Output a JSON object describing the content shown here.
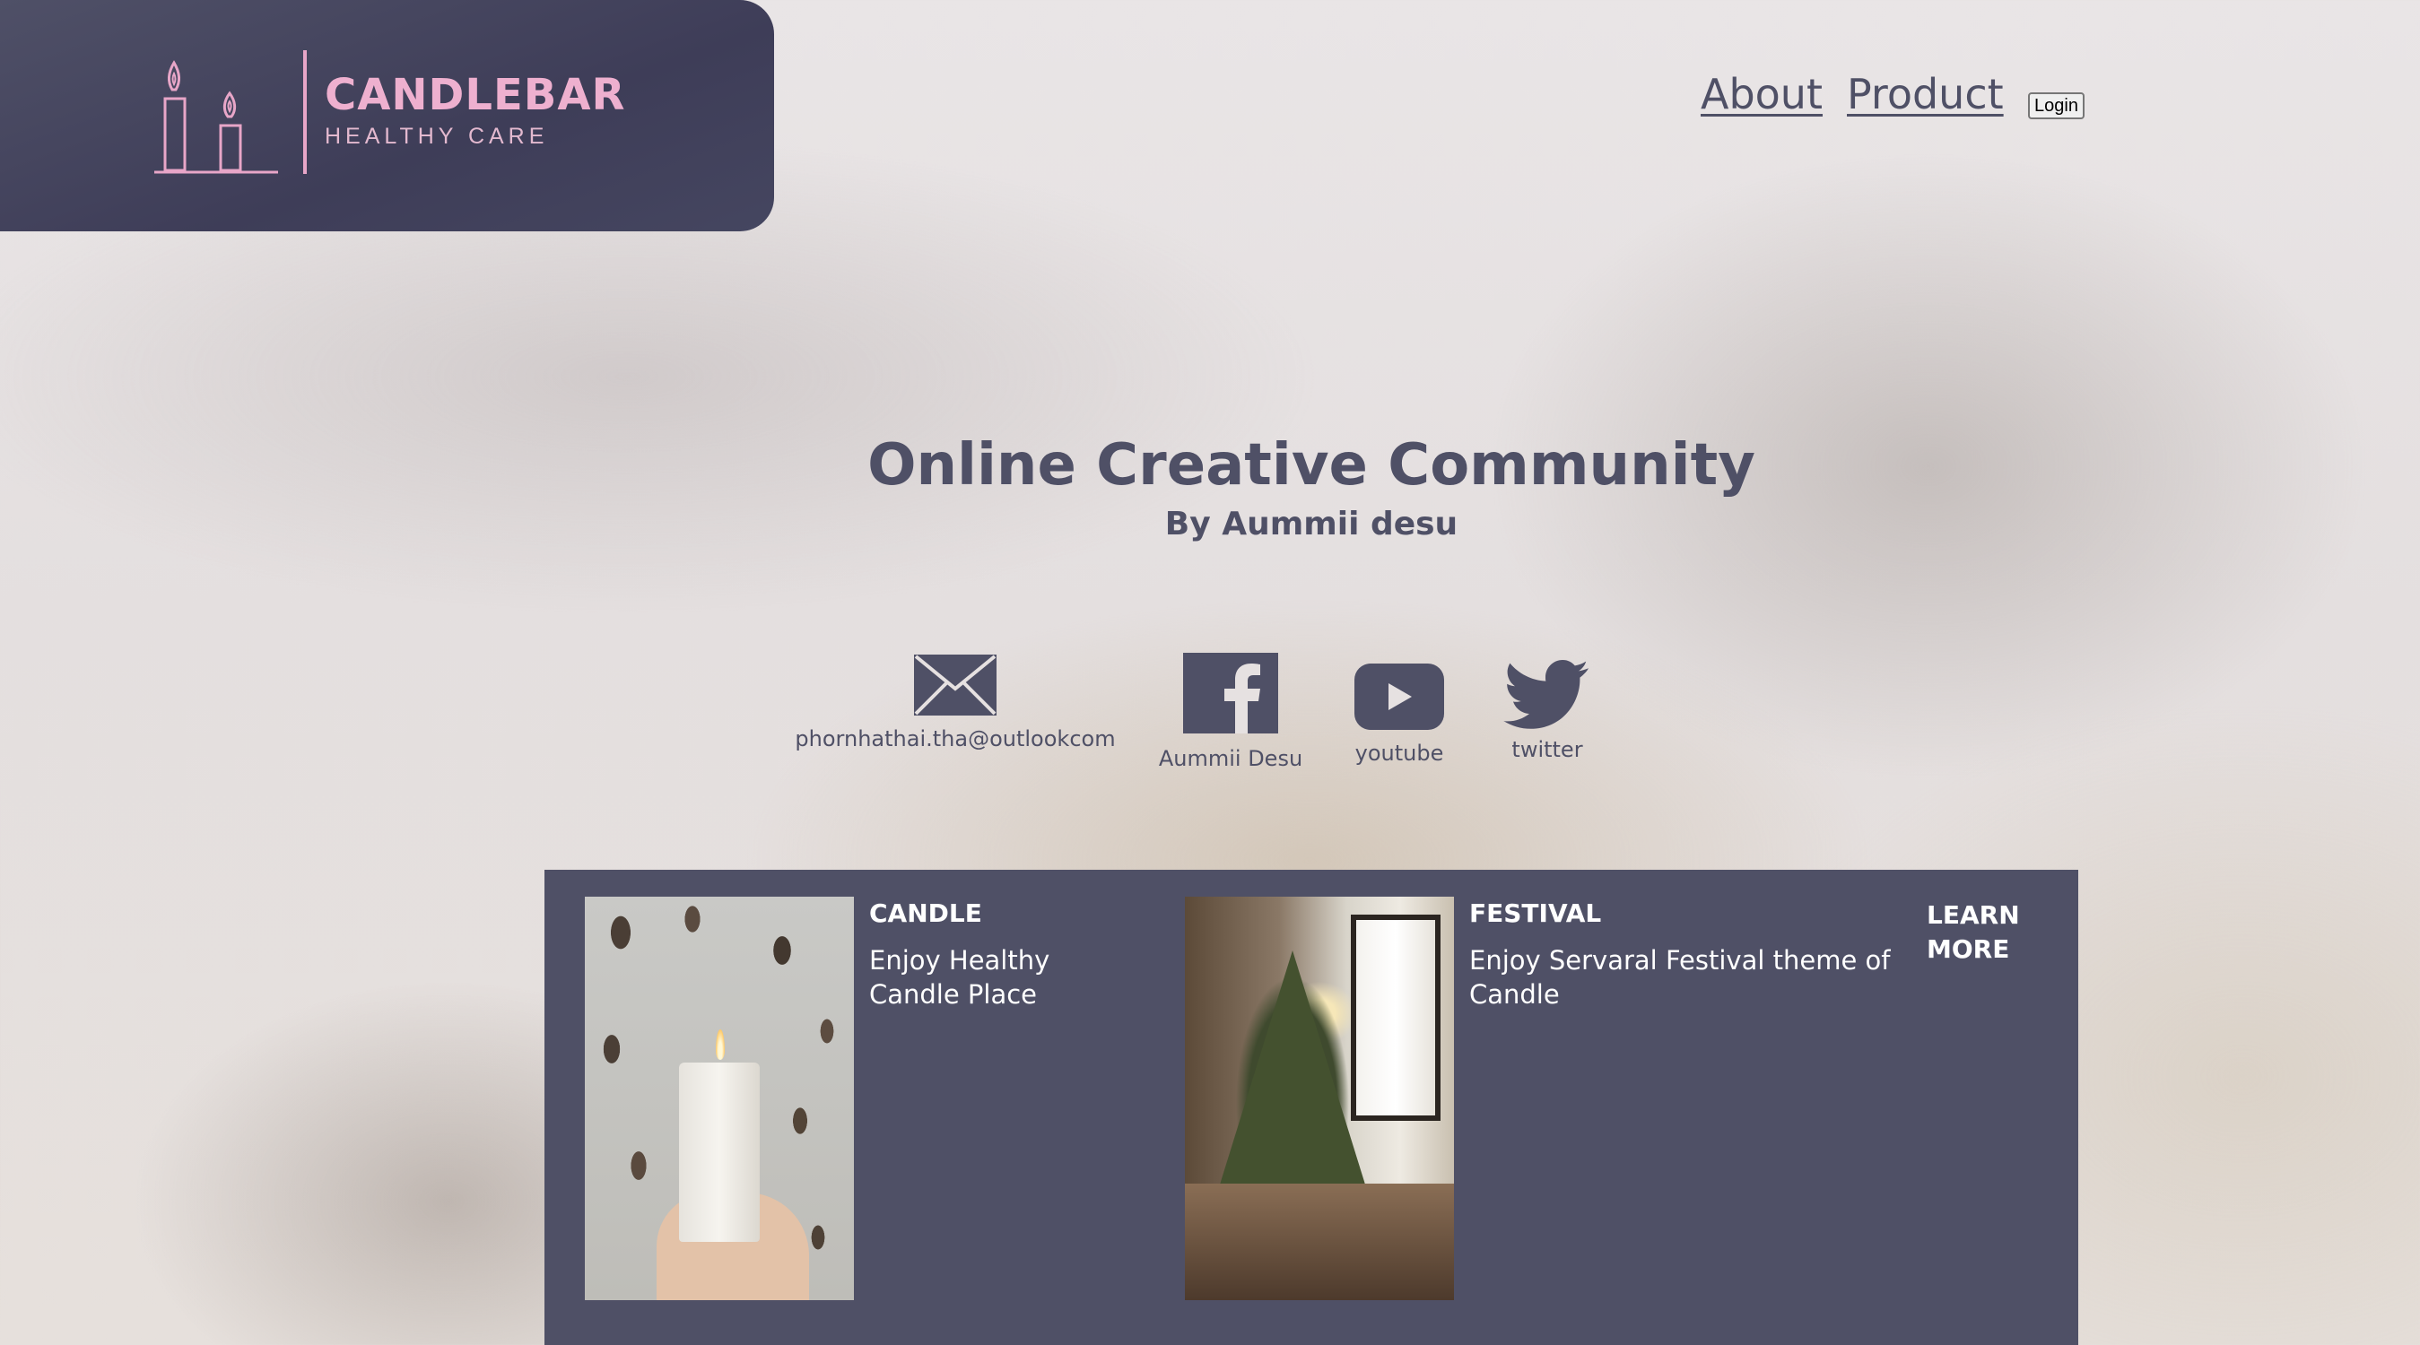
{
  "brand": {
    "name": "CANDLEBAR",
    "tagline": "HEALTHY CARE",
    "accent_color": "#eeb0cf",
    "panel_color": "#4f5066"
  },
  "nav": {
    "items": [
      {
        "label": "About"
      },
      {
        "label": "Product"
      }
    ],
    "login_label": "Login"
  },
  "hero": {
    "title": "Online Creative Community",
    "subtitle": "By Aummii desu"
  },
  "social": [
    {
      "icon": "mail-icon",
      "label": "phornhathai.tha@outlookcom"
    },
    {
      "icon": "facebook-icon",
      "label": "Aummii Desu"
    },
    {
      "icon": "youtube-icon",
      "label": "youtube"
    },
    {
      "icon": "twitter-icon",
      "label": "twitter"
    }
  ],
  "features": {
    "cards": [
      {
        "heading": "CANDLE",
        "text": "Enjoy Healthy Candle Place",
        "image": "candle-photo"
      },
      {
        "heading": "FESTIVAL",
        "text": "Enjoy Servaral Festival theme of Candle",
        "image": "festival-photo"
      }
    ],
    "learn_more": "LEARN MORE"
  }
}
